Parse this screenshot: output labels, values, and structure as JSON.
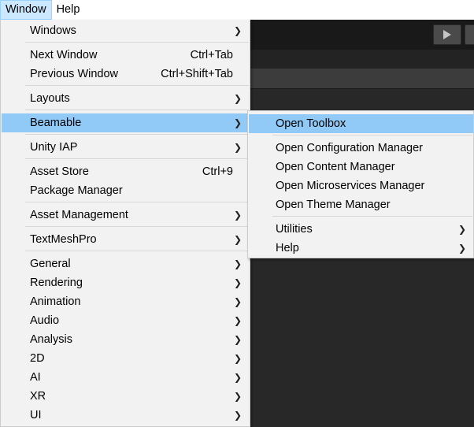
{
  "menubar": {
    "items": [
      {
        "label": "Window"
      },
      {
        "label": "Help"
      }
    ]
  },
  "window_menu": {
    "items": [
      {
        "label": "Windows",
        "shortcut": "",
        "submenu": true
      },
      {
        "label": "Next Window",
        "shortcut": "Ctrl+Tab",
        "submenu": false
      },
      {
        "label": "Previous Window",
        "shortcut": "Ctrl+Shift+Tab",
        "submenu": false
      },
      {
        "label": "Layouts",
        "shortcut": "",
        "submenu": true
      },
      {
        "label": "Beamable",
        "shortcut": "",
        "submenu": true,
        "highlighted": true
      },
      {
        "label": "Unity IAP",
        "shortcut": "",
        "submenu": true
      },
      {
        "label": "Asset Store",
        "shortcut": "Ctrl+9",
        "submenu": false
      },
      {
        "label": "Package Manager",
        "shortcut": "",
        "submenu": false
      },
      {
        "label": "Asset Management",
        "shortcut": "",
        "submenu": true
      },
      {
        "label": "TextMeshPro",
        "shortcut": "",
        "submenu": true
      },
      {
        "label": "General",
        "shortcut": "",
        "submenu": true
      },
      {
        "label": "Rendering",
        "shortcut": "",
        "submenu": true
      },
      {
        "label": "Animation",
        "shortcut": "",
        "submenu": true
      },
      {
        "label": "Audio",
        "shortcut": "",
        "submenu": true
      },
      {
        "label": "Analysis",
        "shortcut": "",
        "submenu": true
      },
      {
        "label": "2D",
        "shortcut": "",
        "submenu": true
      },
      {
        "label": "AI",
        "shortcut": "",
        "submenu": true
      },
      {
        "label": "XR",
        "shortcut": "",
        "submenu": true
      },
      {
        "label": "UI",
        "shortcut": "",
        "submenu": true
      }
    ]
  },
  "beamable_submenu": {
    "items": [
      {
        "label": "Open Toolbox",
        "submenu": false,
        "highlighted": true
      },
      {
        "label": "Open Configuration Manager",
        "submenu": false
      },
      {
        "label": "Open Content Manager",
        "submenu": false
      },
      {
        "label": "Open Microservices Manager",
        "submenu": false
      },
      {
        "label": "Open Theme Manager",
        "submenu": false
      },
      {
        "label": "Utilities",
        "submenu": true
      },
      {
        "label": "Help",
        "submenu": true
      }
    ]
  },
  "icons": {
    "submenu_arrow": "chevron-right-icon",
    "play": "play-icon"
  },
  "colors": {
    "highlight": "#91c9f7",
    "menubar_active": "#cce8ff",
    "menu_bg": "#f2f2f2",
    "editor_bg": "#282828"
  }
}
